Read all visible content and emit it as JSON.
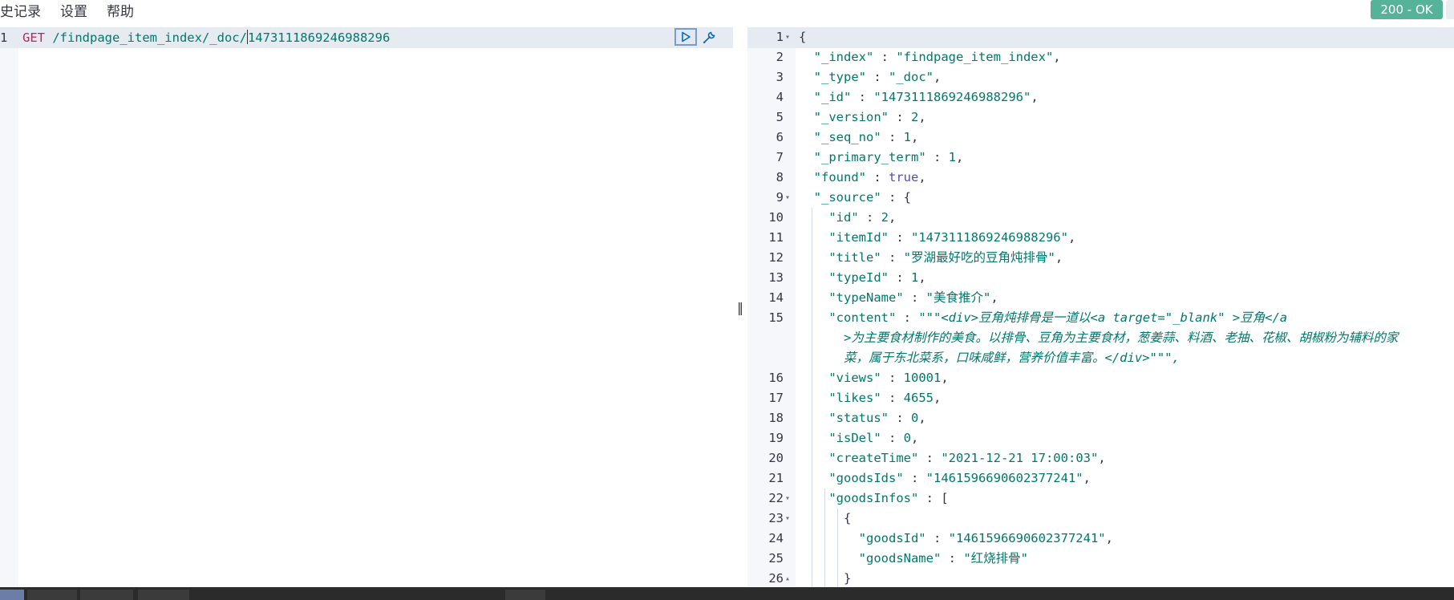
{
  "menu": {
    "items": [
      "史记录",
      "设置",
      "帮助"
    ]
  },
  "status": {
    "label": "200 - OK",
    "color": "#54b399"
  },
  "request": {
    "line_number": "1",
    "method": "GET",
    "path_before_cursor": " /findpage_item_index/_doc/",
    "path_after_cursor": "1473111869246988296",
    "run_icon": "play-icon",
    "settings_icon": "wrench-icon"
  },
  "splitter": {
    "glyph": "‖"
  },
  "response": {
    "lines": [
      {
        "n": "1",
        "fold": "open",
        "t": "{"
      },
      {
        "n": "2",
        "t": "  \"_index\" : \"findpage_item_index\","
      },
      {
        "n": "3",
        "t": "  \"_type\" : \"_doc\","
      },
      {
        "n": "4",
        "t": "  \"_id\" : \"1473111869246988296\","
      },
      {
        "n": "5",
        "t": "  \"_version\" : 2,"
      },
      {
        "n": "6",
        "t": "  \"_seq_no\" : 1,"
      },
      {
        "n": "7",
        "t": "  \"_primary_term\" : 1,"
      },
      {
        "n": "8",
        "t": "  \"found\" : true,"
      },
      {
        "n": "9",
        "fold": "open",
        "t": "  \"_source\" : {"
      },
      {
        "n": "10",
        "t": "    \"id\" : 2,"
      },
      {
        "n": "11",
        "t": "    \"itemId\" : \"1473111869246988296\","
      },
      {
        "n": "12",
        "t": "    \"title\" : \"罗湖最好吃的豆角炖排骨\","
      },
      {
        "n": "13",
        "t": "    \"typeId\" : 1,"
      },
      {
        "n": "14",
        "t": "    \"typeName\" : \"美食推介\","
      },
      {
        "n": "15",
        "wrap": true,
        "t1": "    \"content\" : \"\"\"<div>豆角炖排骨是一道以<a target=\"_blank\" >豆角</a",
        "t2": "      >为主要食材制作的美食。以排骨、豆角为主要食材，葱姜蒜、料酒、老抽、花椒、胡椒粉为辅料的家",
        "t3": "      菜，属于东北菜系，口味咸鲜，营养价值丰富。</div>\"\"\","
      },
      {
        "n": "16",
        "t": "    \"views\" : 10001,"
      },
      {
        "n": "17",
        "t": "    \"likes\" : 4655,"
      },
      {
        "n": "18",
        "t": "    \"status\" : 0,"
      },
      {
        "n": "19",
        "t": "    \"isDel\" : 0,"
      },
      {
        "n": "20",
        "t": "    \"createTime\" : \"2021-12-21 17:00:03\","
      },
      {
        "n": "21",
        "t": "    \"goodsIds\" : \"1461596690602377241\","
      },
      {
        "n": "22",
        "fold": "open",
        "t": "    \"goodsInfos\" : ["
      },
      {
        "n": "23",
        "fold": "open",
        "t": "      {"
      },
      {
        "n": "24",
        "t": "        \"goodsId\" : \"1461596690602377241\","
      },
      {
        "n": "25",
        "t": "        \"goodsName\" : \"红烧排骨\""
      },
      {
        "n": "26",
        "fold": "closed",
        "t": "      }"
      }
    ]
  }
}
